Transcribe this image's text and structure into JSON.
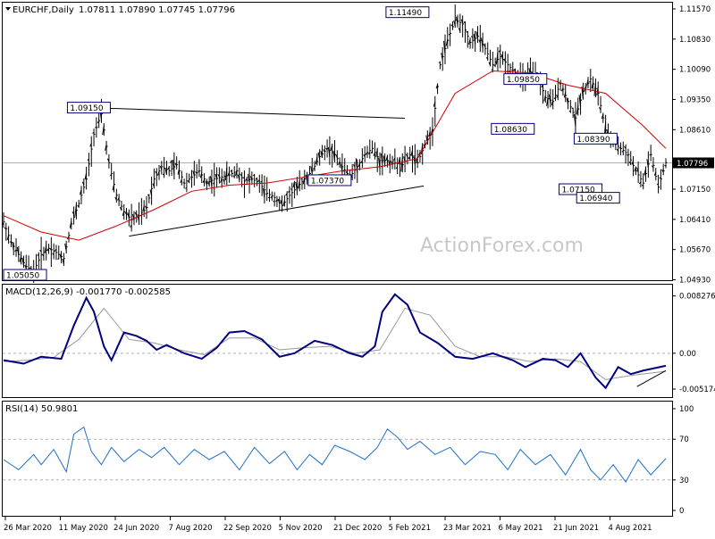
{
  "header": {
    "symbol": "EURCHF,Daily",
    "ohlc": "1.07811 1.07890 1.07745 1.07796"
  },
  "watermark": "ActionForex.com",
  "colors": {
    "price": "#000000",
    "sma": "#cc0000",
    "macd": "#000080",
    "signal": "#999999",
    "rsi": "#1e6fc8",
    "label_border": "#000080",
    "label_bg": "#ffffff",
    "current_bg": "#000000",
    "current_text": "#ffffff"
  },
  "chart_data": [
    {
      "type": "candlestick",
      "title": "EURCHF,Daily",
      "ylim": [
        1.0505,
        1.1157
      ],
      "y_ticks": [
        "1.11570",
        "1.10830",
        "1.10090",
        "1.09350",
        "1.08610",
        "1.07796",
        "1.07150",
        "1.06410",
        "1.05670",
        "1.04930"
      ],
      "current_price": "1.07796",
      "x_labels": [
        "26 Mar 2020",
        "11 May 2020",
        "24 Jun 2020",
        "7 Aug 2020",
        "22 Sep 2020",
        "5 Nov 2020",
        "21 Dec 2020",
        "5 Feb 2021",
        "23 Mar 2021",
        "6 May 2021",
        "21 Jun 2021",
        "4 Aug 2021"
      ],
      "series": [
        {
          "name": "price",
          "x": [
            0,
            6,
            12,
            18,
            24,
            30,
            36,
            42,
            48,
            54,
            60,
            66,
            72,
            78,
            84,
            90,
            96,
            102,
            108,
            114,
            120,
            126,
            132,
            138,
            144,
            150,
            156,
            162,
            168,
            174,
            180,
            186,
            192,
            198,
            204,
            210,
            216,
            222,
            228,
            234,
            240,
            246,
            252,
            258,
            264,
            270,
            276,
            282,
            288,
            294,
            300,
            306,
            312,
            318,
            324,
            330,
            336,
            342,
            348,
            354,
            360,
            366,
            372,
            378,
            384,
            390,
            396,
            402,
            408,
            414,
            420,
            426,
            432,
            438,
            444,
            450,
            456,
            462,
            468,
            474,
            480,
            486,
            492,
            498,
            504,
            510,
            516,
            522,
            528
          ],
          "values": [
            1.0635,
            1.0585,
            1.0555,
            1.0525,
            1.0515,
            1.0555,
            1.057,
            1.056,
            1.0545,
            1.063,
            1.068,
            1.074,
            1.085,
            1.09,
            1.078,
            1.07,
            1.066,
            1.064,
            1.065,
            1.067,
            1.074,
            1.077,
            1.076,
            1.0775,
            1.073,
            1.0745,
            1.076,
            1.073,
            1.074,
            1.0745,
            1.075,
            1.076,
            1.0735,
            1.074,
            1.073,
            1.0705,
            1.0695,
            1.0675,
            1.07,
            1.072,
            1.074,
            1.076,
            1.0795,
            1.0815,
            1.08,
            1.077,
            1.0745,
            1.077,
            1.08,
            1.0815,
            1.0785,
            1.0785,
            1.078,
            1.0775,
            1.08,
            1.078,
            1.0825,
            1.086,
            1.102,
            1.108,
            1.113,
            1.112,
            1.1075,
            1.109,
            1.106,
            1.102,
            1.104,
            1.102,
            1.1,
            1.0985,
            1.1,
            1.099,
            1.094,
            1.093,
            1.0975,
            1.093,
            1.089,
            1.0955,
            1.0985,
            1.095,
            1.086,
            1.083,
            1.0815,
            1.08,
            1.076,
            1.073,
            1.08,
            1.072,
            1.078
          ]
        },
        {
          "name": "sma",
          "x": [
            0,
            30,
            60,
            90,
            120,
            150,
            180,
            210,
            240,
            270,
            300,
            330,
            360,
            390,
            420,
            450,
            480,
            510,
            528
          ],
          "values": [
            1.065,
            1.061,
            1.059,
            1.0625,
            1.0665,
            1.071,
            1.0725,
            1.073,
            1.0745,
            1.076,
            1.077,
            1.079,
            1.095,
            1.1005,
            1.1,
            1.097,
            1.095,
            1.087,
            1.0815
          ]
        }
      ],
      "lines": [
        {
          "x": [
            68,
            320
          ],
          "values": [
            1.0915,
            1.0889
          ]
        },
        {
          "x": [
            100,
            335
          ],
          "values": [
            1.06,
            1.0723
          ]
        }
      ],
      "annotations": [
        {
          "text": "1.11490",
          "x": 322,
          "value": 1.1149
        },
        {
          "text": "1.09150",
          "x": 68,
          "value": 1.0915
        },
        {
          "text": "1.09850",
          "x": 416,
          "value": 1.0985
        },
        {
          "text": "1.08630",
          "x": 406,
          "value": 1.0863
        },
        {
          "text": "1.08390",
          "x": 472,
          "value": 1.0839
        },
        {
          "text": "1.07370",
          "x": 260,
          "value": 1.0737
        },
        {
          "text": "1.07150",
          "x": 460,
          "value": 1.0715
        },
        {
          "text": "1.06940",
          "x": 474,
          "value": 1.0694
        },
        {
          "text": "1.05050",
          "x": 10,
          "value": 1.0505
        }
      ]
    },
    {
      "type": "line",
      "title": "MACD(12,26,9) -0.001770 -0.002585",
      "ylim": [
        -0.0062,
        0.009
      ],
      "y_ticks": [
        "0.008276",
        "0.00",
        "-0.005174"
      ],
      "series": [
        {
          "name": "macd",
          "x": [
            0,
            16,
            30,
            46,
            56,
            66,
            72,
            80,
            86,
            96,
            106,
            114,
            122,
            130,
            144,
            158,
            170,
            180,
            192,
            206,
            220,
            232,
            248,
            262,
            276,
            286,
            296,
            302,
            312,
            322,
            332,
            346,
            360,
            374,
            390,
            406,
            416,
            430,
            440,
            450,
            460,
            472,
            480,
            490,
            500,
            510,
            528
          ],
          "values": [
            -0.001,
            -0.0015,
            -0.0005,
            -0.0008,
            0.004,
            0.008,
            0.006,
            0.001,
            -0.001,
            0.003,
            0.0025,
            0.0018,
            0.0005,
            0.0012,
            0.0,
            -0.0008,
            0.0008,
            0.003,
            0.0032,
            0.002,
            -0.0005,
            0.0,
            0.0018,
            0.0012,
            0.0,
            -0.0005,
            0.001,
            0.006,
            0.0085,
            0.007,
            0.003,
            0.0015,
            -0.0005,
            -0.0008,
            0.0,
            -0.001,
            -0.002,
            -0.0008,
            -0.001,
            -0.002,
            0.0,
            -0.0035,
            -0.005,
            -0.002,
            -0.003,
            -0.0025,
            -0.0018
          ]
        },
        {
          "name": "signal",
          "x": [
            0,
            20,
            40,
            60,
            80,
            100,
            120,
            140,
            160,
            180,
            200,
            220,
            240,
            260,
            280,
            300,
            320,
            340,
            360,
            380,
            400,
            420,
            440,
            460,
            480,
            500,
            528
          ],
          "values": [
            -0.0012,
            -0.001,
            -0.0006,
            0.002,
            0.0065,
            0.002,
            0.0015,
            0.0005,
            -0.0002,
            0.0022,
            0.0022,
            0.0005,
            0.0008,
            0.001,
            0.0,
            0.0005,
            0.0065,
            0.0055,
            0.001,
            -0.0005,
            -0.0005,
            -0.0012,
            -0.0008,
            -0.0012,
            -0.0038,
            -0.0032,
            -0.0026
          ]
        }
      ],
      "lines": [
        {
          "x": [
            505,
            528
          ],
          "values": [
            -0.0048,
            -0.0025
          ]
        }
      ]
    },
    {
      "type": "line",
      "title": "RSI(14) 50.9801",
      "ylim": [
        0,
        100
      ],
      "y_ticks": [
        "100",
        "70",
        "30",
        "0"
      ],
      "levels": [
        70,
        30
      ],
      "series": [
        {
          "name": "rsi",
          "x": [
            0,
            12,
            24,
            30,
            40,
            50,
            56,
            64,
            70,
            78,
            86,
            96,
            108,
            118,
            128,
            140,
            152,
            164,
            176,
            188,
            200,
            212,
            224,
            234,
            244,
            254,
            264,
            276,
            288,
            298,
            306,
            314,
            322,
            332,
            344,
            356,
            368,
            380,
            392,
            402,
            412,
            424,
            436,
            448,
            460,
            468,
            476,
            486,
            496,
            506,
            516,
            528
          ],
          "values": [
            50,
            40,
            55,
            45,
            60,
            38,
            75,
            82,
            58,
            45,
            62,
            48,
            60,
            52,
            62,
            45,
            60,
            50,
            58,
            40,
            62,
            46,
            58,
            40,
            55,
            45,
            64,
            58,
            50,
            62,
            80,
            72,
            60,
            68,
            55,
            62,
            45,
            58,
            55,
            40,
            60,
            45,
            55,
            35,
            60,
            40,
            30,
            45,
            28,
            50,
            35,
            51
          ]
        }
      ]
    }
  ]
}
